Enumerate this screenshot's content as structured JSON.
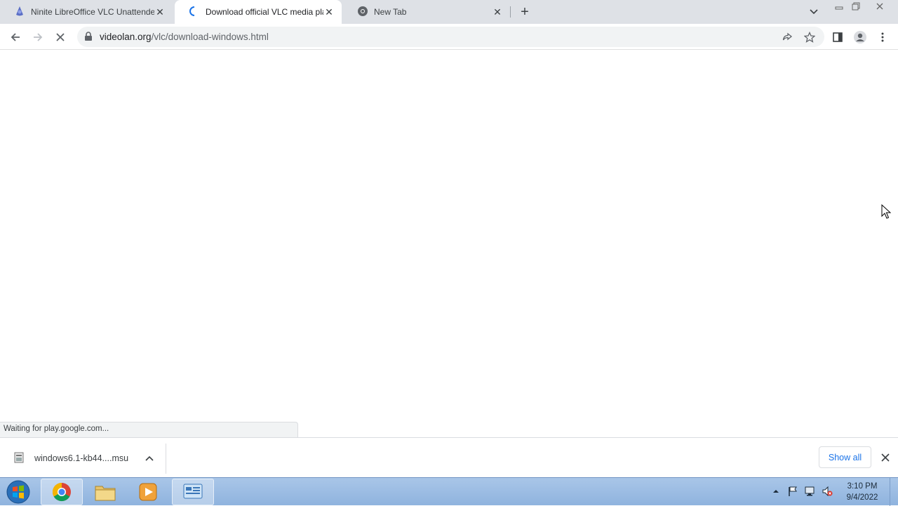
{
  "browser": {
    "tabs": [
      {
        "title": "Ninite LibreOffice VLC Unattende",
        "icon": "ninite-favicon-icon",
        "active": false
      },
      {
        "title": "Download official VLC media pla",
        "icon": "loading-spinner-icon",
        "active": true
      },
      {
        "title": "New Tab",
        "icon": "chrome-favicon-icon",
        "active": false
      }
    ],
    "url": {
      "domain": "videolan.org",
      "path": "/vlc/download-windows.html"
    }
  },
  "status_text": "Waiting for play.google.com...",
  "download_shelf": {
    "filename": "windows6.1-kb44....msu",
    "show_all_label": "Show all"
  },
  "taskbar": {
    "time": "3:10 PM",
    "date": "9/4/2022"
  },
  "colors": {
    "tabstrip": "#dee1e6",
    "accent": "#1a73e8",
    "taskbar": "#8fb3de"
  }
}
